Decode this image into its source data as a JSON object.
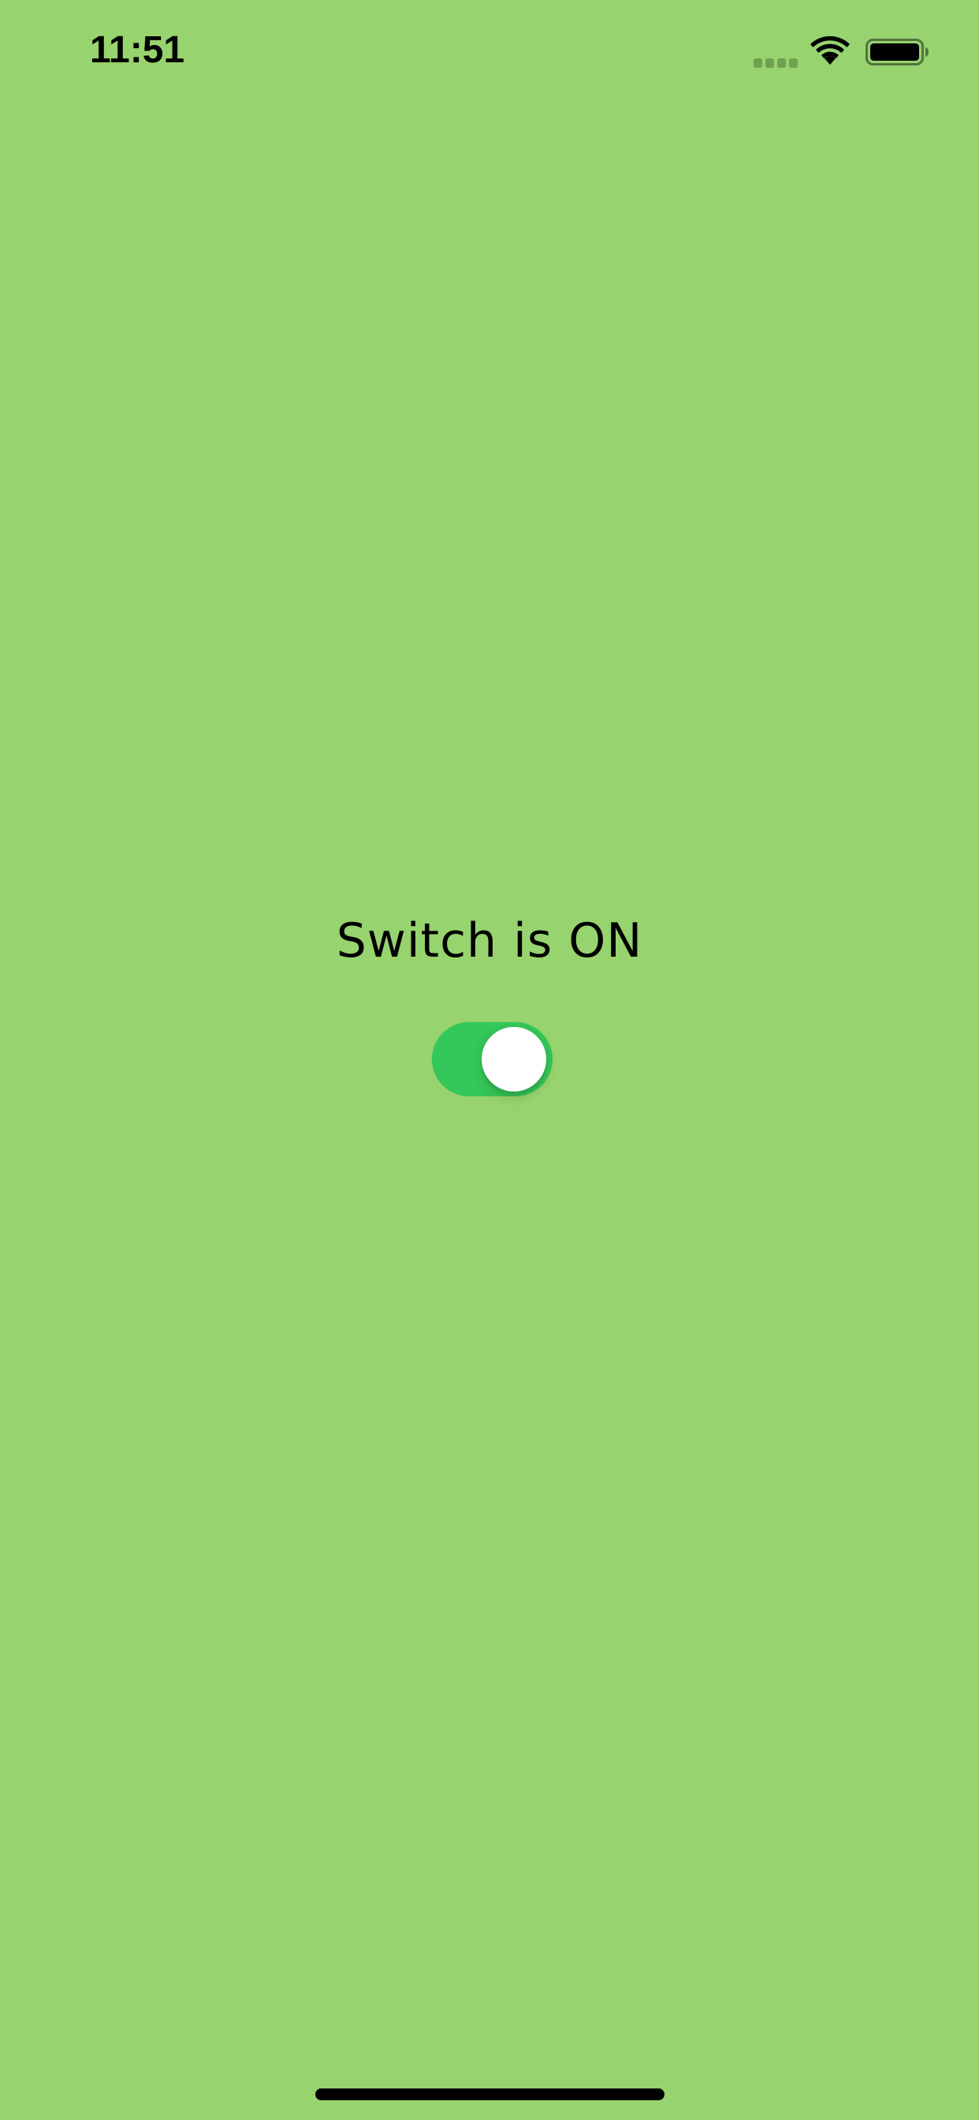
{
  "status_bar": {
    "time": "11:51",
    "signal_icon": "cellular-signal-icon",
    "wifi_icon": "wifi-icon",
    "battery_icon": "battery-icon"
  },
  "main": {
    "switch_label": "Switch is ON",
    "switch_state": "on",
    "switch_on_color": "#34c759"
  },
  "colors": {
    "background": "#97d36e",
    "text": "#000000",
    "knob": "#ffffff"
  }
}
